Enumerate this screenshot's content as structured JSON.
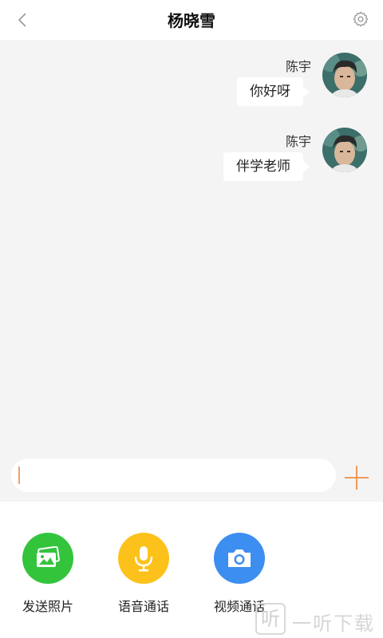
{
  "header": {
    "title": "杨晓雪"
  },
  "messages": [
    {
      "sender": "陈宇",
      "text": "你好呀"
    },
    {
      "sender": "陈宇",
      "text": "伴学老师"
    }
  ],
  "composer": {
    "value": "",
    "placeholder": ""
  },
  "actions": [
    {
      "label": "发送照片",
      "icon": "photo-icon",
      "color": "#33c43c"
    },
    {
      "label": "语音通话",
      "icon": "microphone-icon",
      "color": "#fcc21b"
    },
    {
      "label": "视频通话",
      "icon": "camera-icon",
      "color": "#3c8ef0"
    }
  ],
  "colors": {
    "accent": "#ef9a5a",
    "chat_background": "#f4f4f4"
  },
  "watermark": {
    "text": "一听下载"
  }
}
